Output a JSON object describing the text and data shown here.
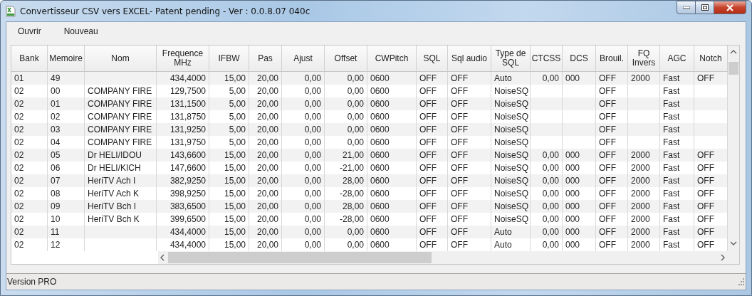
{
  "window": {
    "title": "Convertisseur CSV vers EXCEL- Patent pending - Ver : 0.0.8.07 040c"
  },
  "menu": [
    "Ouvrir",
    "Nouveau"
  ],
  "table": {
    "columns": [
      "Bank",
      "Memoire",
      "Nom",
      "Frequence\nMHz",
      "IFBW",
      "Pas",
      "Ajust",
      "Offset",
      "CWPitch",
      "SQL",
      "Sql audio",
      "Type de\nSQL",
      "CTCSS",
      "DCS",
      "Brouil.",
      "FQ\nInvers",
      "AGC",
      "Notch"
    ],
    "rows": [
      [
        "01",
        "49",
        null,
        "434,4000",
        "15,00",
        "20,00",
        "0,00",
        "0,00",
        "0600",
        "OFF",
        "OFF",
        "Auto",
        "0,00",
        "000",
        "OFF",
        "2000",
        "Fast",
        "OFF"
      ],
      [
        "02",
        "00",
        "COMPANY FIRE",
        "129,7500",
        "5,00",
        "20,00",
        "0,00",
        "0,00",
        "0600",
        "OFF",
        "OFF",
        "NoiseSQ",
        null,
        null,
        "OFF",
        null,
        "Fast",
        null
      ],
      [
        "02",
        "01",
        "COMPANY FIRE",
        "131,1500",
        "5,00",
        "20,00",
        "0,00",
        "0,00",
        "0600",
        "OFF",
        "OFF",
        "NoiseSQ",
        null,
        null,
        "OFF",
        null,
        "Fast",
        null
      ],
      [
        "02",
        "02",
        "COMPANY FIRE",
        "131,8750",
        "5,00",
        "20,00",
        "0,00",
        "0,00",
        "0600",
        "OFF",
        "OFF",
        "NoiseSQ",
        null,
        null,
        "OFF",
        null,
        "Fast",
        null
      ],
      [
        "02",
        "03",
        "COMPANY FIRE",
        "131,9250",
        "5,00",
        "20,00",
        "0,00",
        "0,00",
        "0600",
        "OFF",
        "OFF",
        "NoiseSQ",
        null,
        null,
        "OFF",
        null,
        "Fast",
        null
      ],
      [
        "02",
        "04",
        "COMPANY FIRE",
        "131,9750",
        "5,00",
        "20,00",
        "0,00",
        "0,00",
        "0600",
        "OFF",
        "OFF",
        "NoiseSQ",
        null,
        null,
        "OFF",
        null,
        "Fast",
        null
      ],
      [
        "02",
        "05",
        "Dr HELI/IDOU",
        "143,6600",
        "15,00",
        "20,00",
        "0,00",
        "21,00",
        "0600",
        "OFF",
        "OFF",
        "NoiseSQ",
        "0,00",
        "000",
        "OFF",
        "2000",
        "Fast",
        "OFF"
      ],
      [
        "02",
        "06",
        "Dr HELI/KICH",
        "147,6600",
        "15,00",
        "20,00",
        "0,00",
        "-21,00",
        "0600",
        "OFF",
        "OFF",
        "NoiseSQ",
        "0,00",
        "000",
        "OFF",
        "2000",
        "Fast",
        "OFF"
      ],
      [
        "02",
        "07",
        "HeriTV Ach I",
        "382,9250",
        "15,00",
        "20,00",
        "0,00",
        "28,00",
        "0600",
        "OFF",
        "OFF",
        "NoiseSQ",
        "0,00",
        "000",
        "OFF",
        "2000",
        "Fast",
        "OFF"
      ],
      [
        "02",
        "08",
        "HeriTV Ach K",
        "398,9250",
        "15,00",
        "20,00",
        "0,00",
        "-28,00",
        "0600",
        "OFF",
        "OFF",
        "NoiseSQ",
        "0,00",
        "000",
        "OFF",
        "2000",
        "Fast",
        "OFF"
      ],
      [
        "02",
        "09",
        "HeriTV Bch I",
        "383,6500",
        "15,00",
        "20,00",
        "0,00",
        "28,00",
        "0600",
        "OFF",
        "OFF",
        "NoiseSQ",
        "0,00",
        "000",
        "OFF",
        "2000",
        "Fast",
        "OFF"
      ],
      [
        "02",
        "10",
        "HeriTV Bch K",
        "399,6500",
        "15,00",
        "20,00",
        "0,00",
        "-28,00",
        "0600",
        "OFF",
        "OFF",
        "NoiseSQ",
        "0,00",
        "000",
        "OFF",
        "2000",
        "Fast",
        "OFF"
      ],
      [
        "02",
        "11",
        null,
        "434,4000",
        "15,00",
        "20,00",
        "0,00",
        "0,00",
        "0600",
        "OFF",
        "OFF",
        "Auto",
        "0,00",
        "000",
        "OFF",
        "2000",
        "Fast",
        "OFF"
      ],
      [
        "02",
        "12",
        null,
        "434,4000",
        "15,00",
        "20,00",
        "0,00",
        "0,00",
        "0600",
        "OFF",
        "OFF",
        "Auto",
        "0,00",
        "000",
        "OFF",
        "2000",
        "Fast",
        "OFF"
      ]
    ]
  },
  "status_bar": "Version PRO"
}
